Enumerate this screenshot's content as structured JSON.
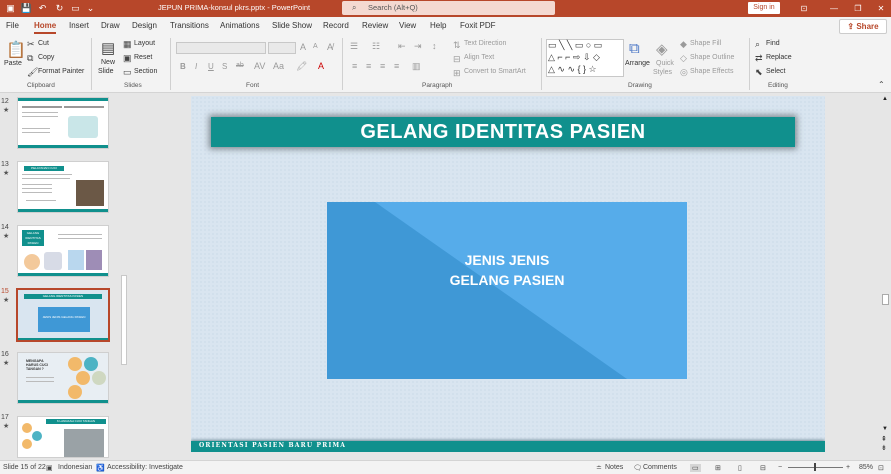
{
  "titlebar": {
    "doc_title": "JEPUN PRIMA-konsul pkrs.pptx  -  PowerPoint",
    "search_placeholder": "Search (Alt+Q)",
    "signin_label": "Sign in",
    "quick_access": [
      "save-icon",
      "undo-icon",
      "redo-icon",
      "start-from-beginning-icon",
      "customize-icon"
    ],
    "colors": {
      "brand": "#b7472a"
    }
  },
  "tabs": [
    "File",
    "Home",
    "Insert",
    "Draw",
    "Design",
    "Transitions",
    "Animations",
    "Slide Show",
    "Record",
    "Review",
    "View",
    "Help",
    "Foxit PDF"
  ],
  "active_tab": "Home",
  "share_label": "Share",
  "ribbon": {
    "clipboard": {
      "paste": "Paste",
      "cut": "Cut",
      "copy": "Copy",
      "format_painter": "Format Painter",
      "group": "Clipboard"
    },
    "slides": {
      "new_slide_1": "New",
      "new_slide_2": "Slide",
      "layout": "Layout",
      "reset": "Reset",
      "section": "Section",
      "group": "Slides"
    },
    "font": {
      "group": "Font",
      "bold": "B",
      "italic": "I",
      "underline": "U",
      "strike": "S",
      "ab": "ab",
      "grow": "A",
      "shrink": "A"
    },
    "paragraph": {
      "text_direction": "Text Direction",
      "align_text": "Align Text",
      "convert_smartart": "Convert to SmartArt",
      "group": "Paragraph"
    },
    "drawing": {
      "arrange": "Arrange",
      "quick_styles_1": "Quick",
      "quick_styles_2": "Styles",
      "shape_fill": "Shape Fill",
      "shape_outline": "Shape Outline",
      "shape_effects": "Shape Effects",
      "group": "Drawing"
    },
    "editing": {
      "find": "Find",
      "replace": "Replace",
      "select": "Select",
      "group": "Editing"
    }
  },
  "thumbnails": [
    {
      "num": "12",
      "star": "★"
    },
    {
      "num": "13",
      "star": "★"
    },
    {
      "num": "14",
      "star": "★"
    },
    {
      "num": "15",
      "star": "★",
      "selected": true
    },
    {
      "num": "16",
      "star": "★"
    },
    {
      "num": "17",
      "star": "★"
    }
  ],
  "slide": {
    "title": "GELANG IDENTITAS PASIEN",
    "box_line1": "JENIS JENIS",
    "box_line2": "GELANG PASIEN",
    "footer": "ORIENTASI PASIEN BARU PRIMA",
    "colors": {
      "teal": "#10908d",
      "blue": "#3f98d6",
      "background": "#d9e5f0"
    }
  },
  "thumb_text": {
    "t13_title": "PELAYANAN CUCI",
    "t14_title_1": "GELANG",
    "t14_title_2": "IDENTITAS",
    "t14_title_3": "PASIEN",
    "t15_title": "GELANG IDENTITAS PASIEN",
    "t15_box": "JENIS JENIS GELANG PASIEN",
    "t16_title_1": "MENGAPA",
    "t16_title_2": "HARUS CUCI",
    "t16_title_3": "TANGAN ?",
    "t17_title": "6 LANGKAH CUCI TANGAN"
  },
  "status": {
    "slide_info": "Slide 15 of 22",
    "language": "Indonesian",
    "accessibility": "Accessibility: Investigate",
    "notes": "Notes",
    "comments": "Comments",
    "zoom": "85%",
    "zoom_minus": "−",
    "zoom_plus": "+"
  }
}
